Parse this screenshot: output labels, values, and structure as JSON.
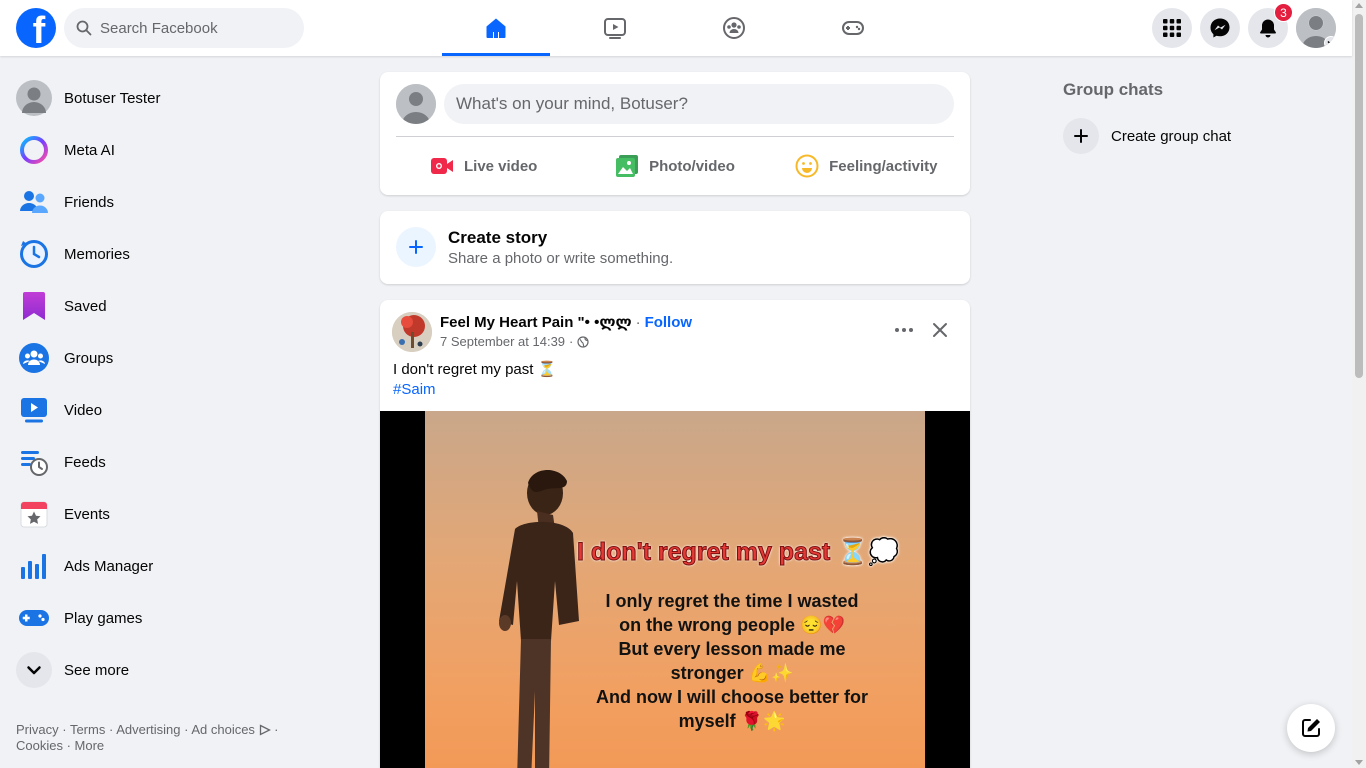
{
  "topbar": {
    "search_placeholder": "Search Facebook",
    "notification_count": "3",
    "tabs": [
      {
        "icon": "home-icon",
        "active": true
      },
      {
        "icon": "video-icon",
        "active": false
      },
      {
        "icon": "groups-icon",
        "active": false
      },
      {
        "icon": "gaming-icon",
        "active": false
      }
    ]
  },
  "sidebar": {
    "items": [
      {
        "label": "Botuser Tester",
        "icon": "profile-avatar"
      },
      {
        "label": "Meta AI",
        "icon": "meta-ai-icon"
      },
      {
        "label": "Friends",
        "icon": "friends-icon"
      },
      {
        "label": "Memories",
        "icon": "memories-icon"
      },
      {
        "label": "Saved",
        "icon": "saved-icon"
      },
      {
        "label": "Groups",
        "icon": "groups-icon"
      },
      {
        "label": "Video",
        "icon": "video-icon"
      },
      {
        "label": "Feeds",
        "icon": "feeds-icon"
      },
      {
        "label": "Events",
        "icon": "events-icon"
      },
      {
        "label": "Ads Manager",
        "icon": "ads-manager-icon"
      },
      {
        "label": "Play games",
        "icon": "play-games-icon"
      },
      {
        "label": "See more",
        "icon": "chevron-down-icon"
      }
    ],
    "footer": {
      "privacy": "Privacy",
      "terms": "Terms",
      "advertising": "Advertising",
      "ad_choices": "Ad choices",
      "cookies": "Cookies",
      "more": "More"
    }
  },
  "composer": {
    "placeholder": "What's on your mind, Botuser?",
    "live_video": "Live video",
    "photo_video": "Photo/video",
    "feeling": "Feeling/activity"
  },
  "story": {
    "title": "Create story",
    "subtitle": "Share a photo or write something."
  },
  "post": {
    "author": "Feel My Heart Pain \"• •ლლ",
    "follow": "Follow",
    "date": "7 September at 14:39",
    "text": "I don't regret my past ⏳",
    "hashtag": "#Saim",
    "image_title": "I don't regret my past ⏳💭",
    "image_lines": [
      "I only regret the time I wasted",
      "on the wrong people 😔💔",
      "But every lesson made me",
      "stronger 💪✨",
      "And now I will choose better for",
      "myself 🌹🌟"
    ]
  },
  "right": {
    "group_chats_title": "Group chats",
    "create_group_chat": "Create group chat"
  },
  "colors": {
    "brand": "#0866ff",
    "badge": "#e41e3f",
    "background": "#f0f2f5"
  }
}
